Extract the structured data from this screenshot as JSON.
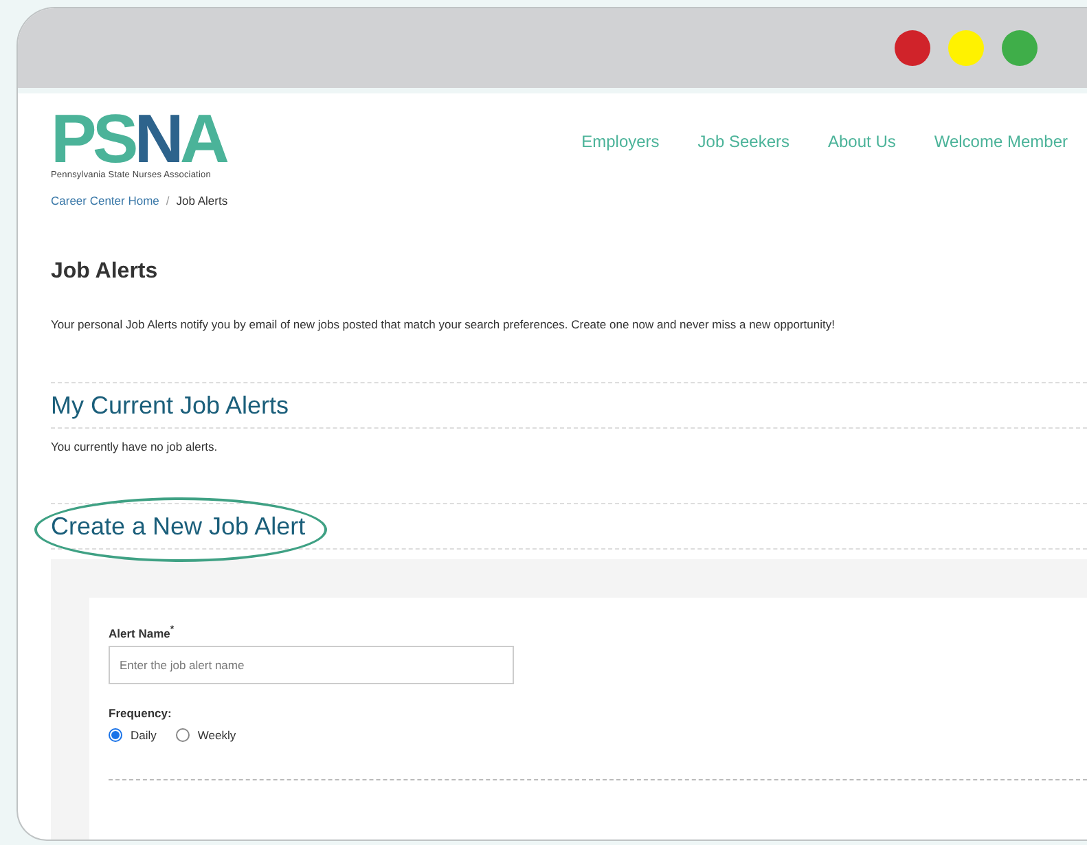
{
  "window": {
    "controls": [
      {
        "color": "#d0232a"
      },
      {
        "color": "#fff200"
      },
      {
        "color": "#3fae49"
      }
    ]
  },
  "header": {
    "logo": {
      "letters": [
        {
          "text": "P",
          "color": "#4bb399"
        },
        {
          "text": "S",
          "color": "#4bb399"
        },
        {
          "text": "N",
          "color": "#2d638c"
        },
        {
          "text": "A",
          "color": "#4bb399"
        }
      ],
      "tagline": "Pennsylvania State Nurses Association"
    },
    "nav": [
      "Employers",
      "Job Seekers",
      "About Us",
      "Welcome Member"
    ]
  },
  "breadcrumb": [
    {
      "label": "Career Center Home",
      "kind": "link"
    },
    {
      "label": "Job Alerts",
      "kind": "current",
      "separator": "/"
    }
  ],
  "page": {
    "title": "Job Alerts",
    "intro": "Your personal Job Alerts notify you by email of new jobs posted that match your search preferences. Create one now and never miss a new opportunity!"
  },
  "current_alerts": {
    "heading": "My Current Job Alerts",
    "empty_text": "You currently have no job alerts."
  },
  "create": {
    "heading": "Create a New Job Alert",
    "highlighted": true,
    "alert_name": {
      "label": "Alert Name",
      "required_mark": "*",
      "placeholder": "Enter the job alert name"
    },
    "frequency": {
      "label": "Frequency:",
      "options": [
        {
          "label": "Daily",
          "selected": true
        },
        {
          "label": "Weekly",
          "selected": false
        }
      ]
    }
  }
}
